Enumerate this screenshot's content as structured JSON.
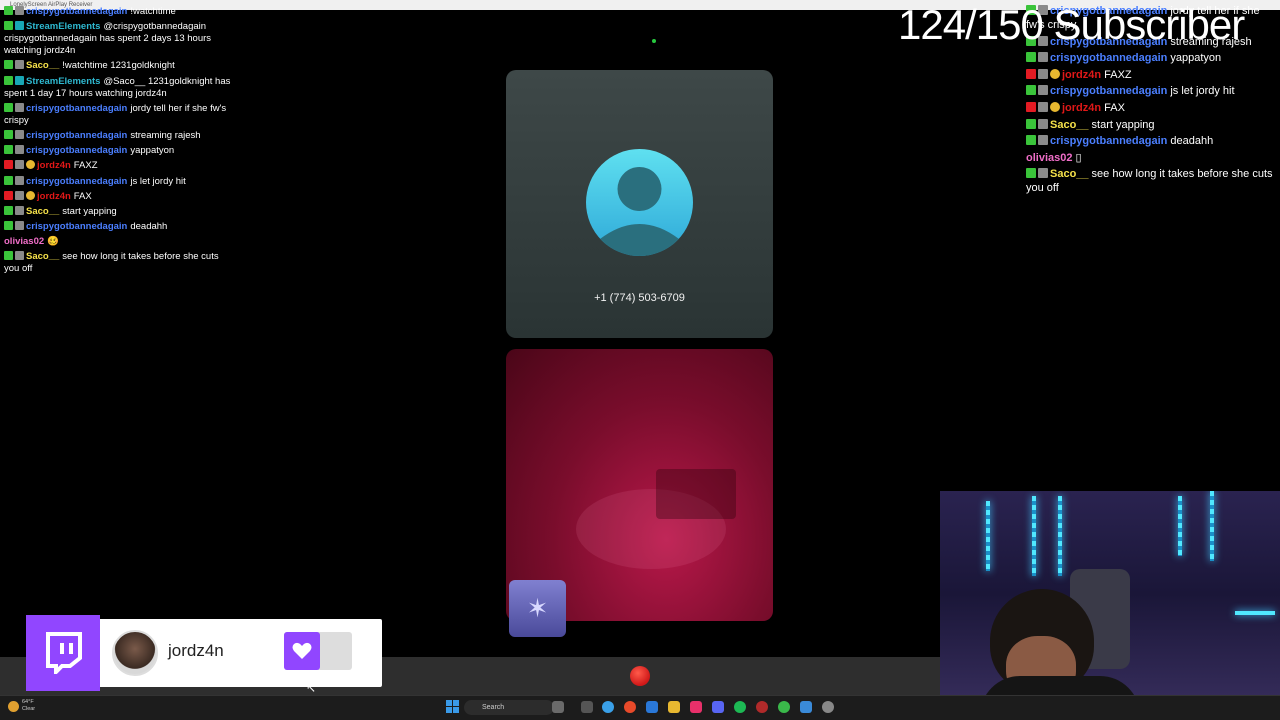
{
  "window": {
    "title": "LonelyScreen AirPlay Receiver"
  },
  "overlay": {
    "subscriber_goal": "124/150 Subscriber"
  },
  "chat_left": {
    "messages": [
      {
        "user": "crispygotbannedagain",
        "text": "!watchtime",
        "color": "#4b7fff"
      },
      {
        "user": "StreamElements",
        "text": "@crispygotbannedagain crispygotbannedagain has spent 2 days 13 hours watching jordz4n",
        "color": "#2eb8d0"
      },
      {
        "user": "Saco__",
        "text": "!watchtime 1231goldknight",
        "color": "#f5e14a"
      },
      {
        "user": "StreamElements",
        "text": "@Saco__ 1231goldknight has spent 1 day 17 hours watching jordz4n",
        "color": "#2eb8d0"
      },
      {
        "user": "crispygotbannedagain",
        "text": "jordy tell her if she fw's crispy",
        "color": "#4b7fff"
      },
      {
        "user": "crispygotbannedagain",
        "text": "streaming rajesh",
        "color": "#4b7fff"
      },
      {
        "user": "crispygotbannedagain",
        "text": "yappatyon",
        "color": "#4b7fff"
      },
      {
        "user": "jordz4n",
        "text": "FAXZ",
        "color": "#e01818"
      },
      {
        "user": "crispygotbannedagain",
        "text": "js let jordy hit",
        "color": "#4b7fff"
      },
      {
        "user": "jordz4n",
        "text": "FAX",
        "color": "#e01818"
      },
      {
        "user": "Saco__",
        "text": "start yapping",
        "color": "#f5e14a"
      },
      {
        "user": "crispygotbannedagain",
        "text": "deadahh",
        "color": "#4b7fff"
      },
      {
        "user": "olivias02",
        "text": "🥴",
        "color": "#f06ec8"
      },
      {
        "user": "Saco__",
        "text": "see how long it takes before she cuts you off",
        "color": "#f5e14a"
      }
    ]
  },
  "chat_right": {
    "messages": [
      {
        "user": "crispygotbannedagain",
        "text": "jordy tell her if she fw's crispy",
        "color": "#4b7fff"
      },
      {
        "user": "crispygotbannedagain",
        "text": "streaming rajesh",
        "color": "#4b7fff"
      },
      {
        "user": "crispygotbannedagain",
        "text": "yappatyon",
        "color": "#4b7fff"
      },
      {
        "user": "jordz4n",
        "text": "FAXZ",
        "color": "#e01818"
      },
      {
        "user": "crispygotbannedagain",
        "text": "js let jordy hit",
        "color": "#4b7fff"
      },
      {
        "user": "jordz4n",
        "text": "FAX",
        "color": "#e01818"
      },
      {
        "user": "Saco__",
        "text": "start yapping",
        "color": "#f5e14a"
      },
      {
        "user": "crispygotbannedagain",
        "text": "deadahh",
        "color": "#4b7fff"
      },
      {
        "user": "olivias02",
        "text": "▯",
        "color": "#f06ec8"
      },
      {
        "user": "Saco__",
        "text": "see how long it takes before she cuts you off",
        "color": "#f5e14a"
      }
    ]
  },
  "call": {
    "phone_number": "+1 (774) 503-6709"
  },
  "twitch_widget": {
    "streamer_name": "jordz4n",
    "logo": "twitch-icon",
    "follow": "heart-icon"
  },
  "taskbar": {
    "weather_temp": "64°F",
    "weather_desc": "Clear",
    "search_label": "Search"
  }
}
